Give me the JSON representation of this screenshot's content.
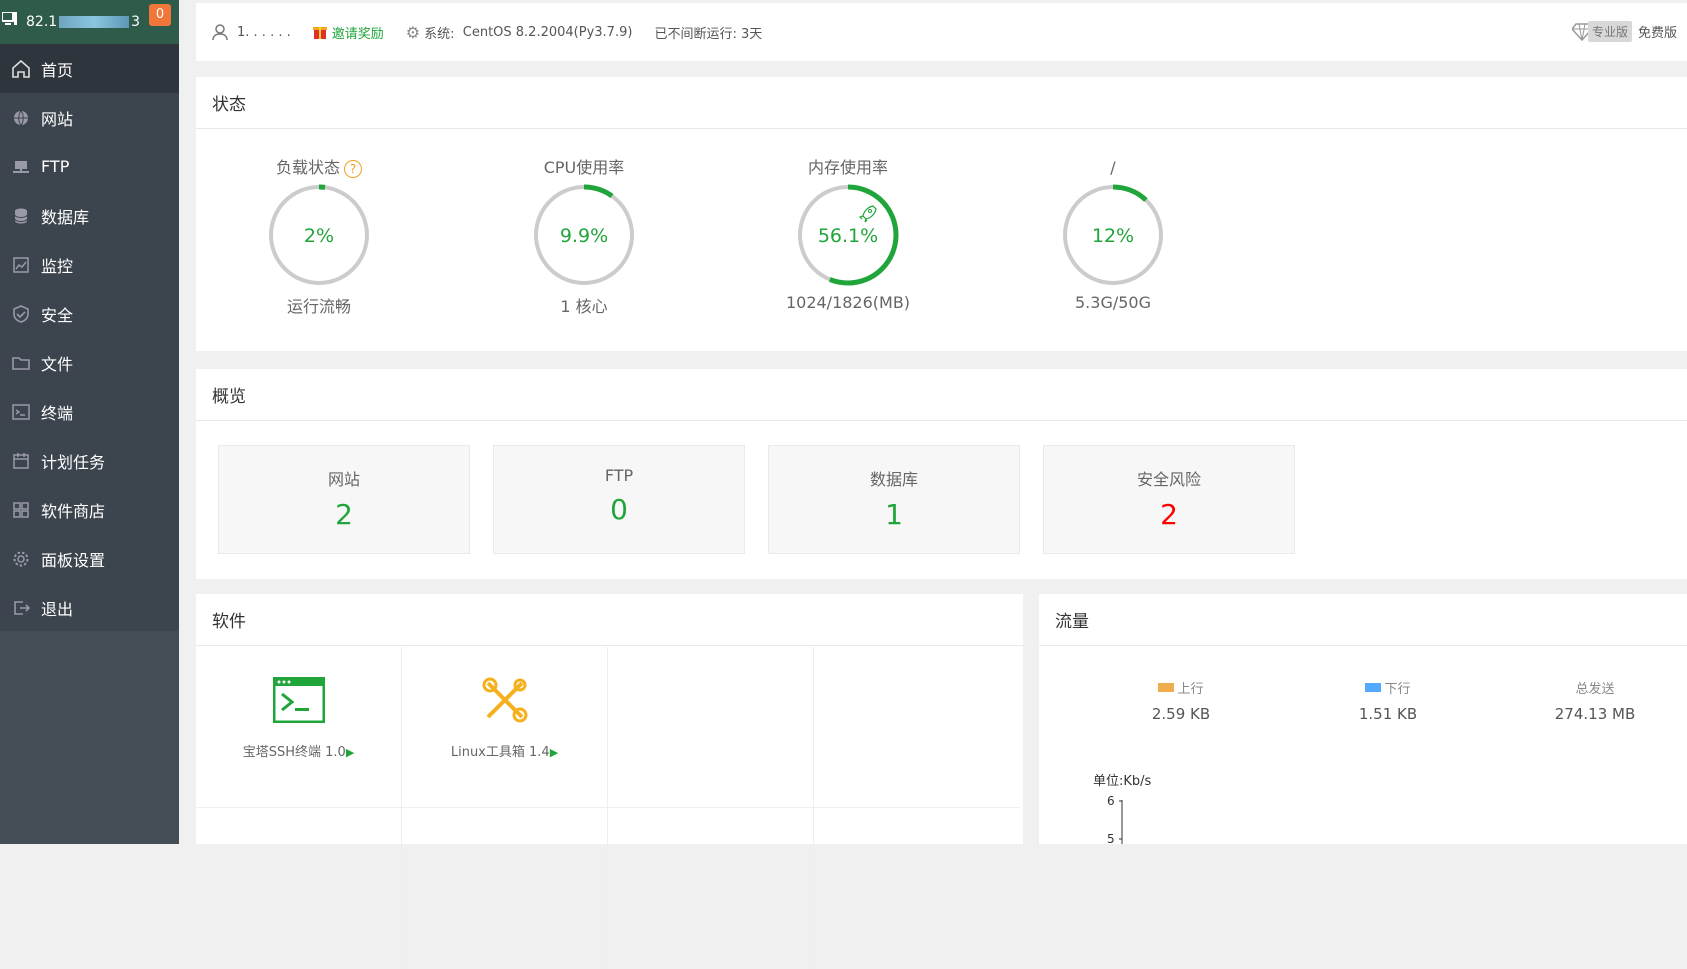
{
  "sidebar": {
    "server_ip_prefix": "82.1",
    "server_ip_suffix": "3",
    "notification_count": "0",
    "items": [
      {
        "label": "首页",
        "icon": "home-icon",
        "active": true
      },
      {
        "label": "网站",
        "icon": "globe-icon"
      },
      {
        "label": "FTP",
        "icon": "ftp-icon"
      },
      {
        "label": "数据库",
        "icon": "database-icon"
      },
      {
        "label": "监控",
        "icon": "monitor-icon"
      },
      {
        "label": "安全",
        "icon": "shield-icon"
      },
      {
        "label": "文件",
        "icon": "folder-icon"
      },
      {
        "label": "终端",
        "icon": "terminal-icon"
      },
      {
        "label": "计划任务",
        "icon": "calendar-icon"
      },
      {
        "label": "软件商店",
        "icon": "grid-icon"
      },
      {
        "label": "面板设置",
        "icon": "gear-icon"
      },
      {
        "label": "退出",
        "icon": "logout-icon"
      }
    ]
  },
  "topbar": {
    "username": "1. .       . . . .",
    "invite_label": "邀请奖励",
    "system_label": "系统:",
    "system_value": "CentOS 8.2.2004(Py3.7.9)",
    "uptime": "已不间断运行: 3天",
    "pro_label": "专业版",
    "edition": "免费版"
  },
  "status": {
    "title": "状态",
    "gauges": [
      {
        "label": "负载状态",
        "value_text": "2%",
        "percent": 2,
        "sub": "运行流畅",
        "has_help": true
      },
      {
        "label": "CPU使用率",
        "value_text": "9.9%",
        "percent": 9.9,
        "sub": "1 核心"
      },
      {
        "label": "内存使用率",
        "value_text": "56.1%",
        "percent": 56.1,
        "sub": "1024/1826(MB)",
        "has_rocket": true
      },
      {
        "label": "/",
        "value_text": "12%",
        "percent": 12,
        "sub": "5.3G/50G"
      }
    ]
  },
  "overview": {
    "title": "概览",
    "cards": [
      {
        "label": "网站",
        "value": "2"
      },
      {
        "label": "FTP",
        "value": "0"
      },
      {
        "label": "数据库",
        "value": "1"
      },
      {
        "label": "安全风险",
        "value": "2",
        "danger": true
      }
    ]
  },
  "software": {
    "title": "软件",
    "items": [
      {
        "name": "宝塔SSH终端 1.0",
        "icon": "terminal-app-icon"
      },
      {
        "name": "Linux工具箱 1.4",
        "icon": "tools-icon"
      }
    ]
  },
  "traffic": {
    "title": "流量",
    "stats": [
      {
        "label": "上行",
        "value": "2.59 KB",
        "color": "#f0ad4e"
      },
      {
        "label": "下行",
        "value": "1.51 KB",
        "color": "#52a9ff"
      },
      {
        "label": "总发送",
        "value": "274.13 MB"
      }
    ],
    "unit": "单位:Kb/s",
    "y_ticks": [
      "6",
      "5"
    ]
  },
  "colors": {
    "accent": "#20a53a",
    "danger": "#ff0000",
    "sidebar_bg": "#3c444d",
    "gauge_track": "#cccccc"
  }
}
